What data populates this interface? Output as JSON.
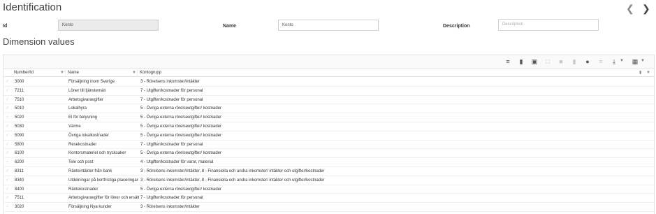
{
  "identification": {
    "title": "Identification",
    "id_label": "Id",
    "id_value": "Konto",
    "name_label": "Name",
    "name_value": "Konto",
    "description_label": "Description",
    "description_placeholder": "Description"
  },
  "dimension_values": {
    "title": "Dimension values",
    "columns": [
      "Number/Id",
      "Name",
      "Kontogrupp"
    ],
    "rows": [
      {
        "id": "3000",
        "name": "Försäljning inom Sverige",
        "group": "3 - Rörelsens inkomster/intäkter"
      },
      {
        "id": "7211",
        "name": "Löner till tjänstemän",
        "group": "7 - Utgifter/kostnader för personal"
      },
      {
        "id": "7510",
        "name": "Arbetsgivaravgifter",
        "group": "7 - Utgifter/kostnader för personal"
      },
      {
        "id": "5010",
        "name": "Lokalhyra",
        "group": "5 - Övriga externa rörelseutgifter/ kostnader"
      },
      {
        "id": "5020",
        "name": "El för belysning",
        "group": "5 - Övriga externa rörelseutgifter/ kostnader"
      },
      {
        "id": "5030",
        "name": "Värme",
        "group": "5 - Övriga externa rörelseutgifter/ kostnader"
      },
      {
        "id": "5090",
        "name": "Övriga lokalkostnader",
        "group": "5 - Övriga externa rörelseutgifter/ kostnader"
      },
      {
        "id": "5800",
        "name": "Resekostnader",
        "group": "7 - Utgifter/kostnader för personal"
      },
      {
        "id": "6100",
        "name": "Kontorsmateriel och trycksaker",
        "group": "5 - Övriga externa rörelseutgifter/ kostnader"
      },
      {
        "id": "6200",
        "name": "Tele och post",
        "group": "4 - Utgifter/kostnader för varor, material"
      },
      {
        "id": "8311",
        "name": "Ränteintäkter från bank",
        "group": "3 - Rörelsens inkomster/intäkter, 8 - Finansiella och andra inkomster/ intäkter och utgifter/kostnader"
      },
      {
        "id": "8340",
        "name": "Utdelningar på kortfristiga placeringar",
        "group": "3 - Rörelsens inkomster/intäkter, 8 - Finansiella och andra inkomster/ intäkter och utgifter/kostnader"
      },
      {
        "id": "8400",
        "name": "Räntekostnader",
        "group": "5 - Övriga externa rörelseutgifter/ kostnader"
      },
      {
        "id": "7511",
        "name": "Arbetsgivaravgifter för löner och ersättningar",
        "group": "7 - Utgifter/kostnader för personal"
      },
      {
        "id": "3020",
        "name": "Försäljning Nya kunder",
        "group": "3 - Rörelsens inkomster/intäkter"
      }
    ]
  },
  "icons": {
    "prev": "chevron-left-icon",
    "next": "chevron-right-icon",
    "toolbar": [
      "add-row-icon",
      "new-document-icon",
      "select-icon",
      "edit-icon",
      "save-icon",
      "delete-icon",
      "info-icon",
      "sort-icon",
      "download-icon",
      "columns-icon"
    ]
  }
}
